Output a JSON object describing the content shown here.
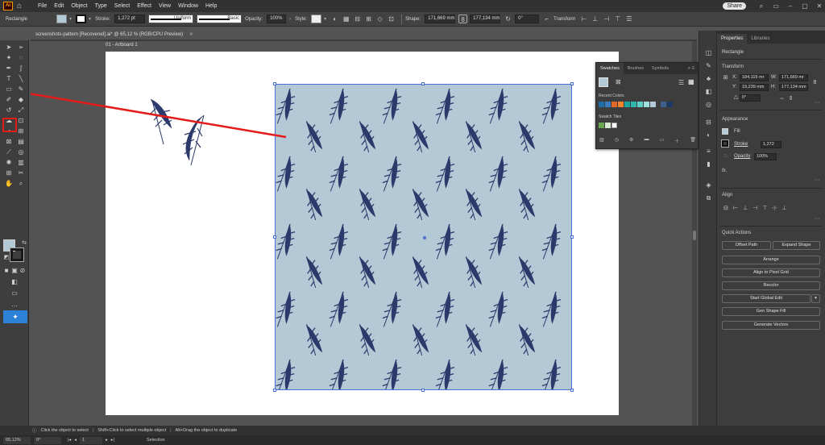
{
  "app": {
    "menus": [
      "File",
      "Edit",
      "Object",
      "Type",
      "Select",
      "Effect",
      "View",
      "Window",
      "Help"
    ],
    "share_label": "Share",
    "window_controls": [
      "minimize-icon",
      "maximize-icon",
      "close-icon"
    ]
  },
  "control_bar": {
    "object_type": "Rectangle",
    "stroke_label": "Stroke:",
    "stroke_value": "1,272 pt",
    "profile": "Uniform",
    "brush": "Basic",
    "opacity_label": "Opacity:",
    "opacity_value": "100%",
    "style_label": "Style:",
    "shape_label": "Shape:",
    "width": "171,669 mm",
    "height": "177,134 mm",
    "angle": "0°",
    "transform_label": "Transform",
    "fill_color": "#b4c9d6"
  },
  "document": {
    "tab_title": "screenshots-pattern [Recovered].ai* @ 65,12 % (RGB/CPU Preview)",
    "artboard_label": "01 - Artboard 1",
    "pattern_color": "#b4c9d6",
    "feather_color": "#2b3a6a",
    "annotation_color": "#e41b1b"
  },
  "swatches": {
    "tabs": [
      "Swatches",
      "Brushes",
      "Symbols"
    ],
    "recent_colors_label": "Recent Colors",
    "swatch_tiles_label": "Swatch Tiles",
    "recent_colors": [
      "#1e6fa8",
      "#3a7dbe",
      "#e06a2a",
      "#f0832e",
      "#1aa7a0",
      "#2fb8b0",
      "#5fd0c8",
      "#9fe0dc",
      "#b4c9d6",
      "#3d5f8a",
      "#1b3a66"
    ]
  },
  "properties": {
    "tabs": [
      "Properties",
      "Libraries"
    ],
    "object_type": "Rectangle",
    "transform_heading": "Transform",
    "x_label": "X:",
    "x_value": "184,115 mr",
    "y_label": "Y:",
    "y_value": "19,239 mm",
    "w_label": "W:",
    "w_value": "171,669 mr",
    "h_label": "H:",
    "h_value": "177,134 mm",
    "angle_value": "0°",
    "appearance_heading": "Appearance",
    "fill_label": "Fill",
    "stroke_label": "Stroke",
    "stroke_value": "1,272",
    "opacity_label": "Opacity",
    "opacity_value": "100%",
    "fx_label": "fx.",
    "align_heading": "Align",
    "quick_actions_heading": "Quick Actions",
    "buttons": {
      "offset_path": "Offset Path",
      "expand_shape": "Expand Shape",
      "arrange": "Arrange",
      "align_pixel": "Align to Pixel Grid",
      "recolor": "Recolor",
      "start_global_edit": "Start Global Edit",
      "gen_shape_fill": "Gen Shape Fill",
      "generate_vectors": "Generate Vectors"
    }
  },
  "status": {
    "hints": [
      "Click the object to select",
      "Shift+Click to select multiple object",
      "Alt+Drag the object to duplicate"
    ],
    "zoom": "65,12%",
    "rotation": "0°",
    "artboard_number": "1",
    "tool": "Selection"
  }
}
